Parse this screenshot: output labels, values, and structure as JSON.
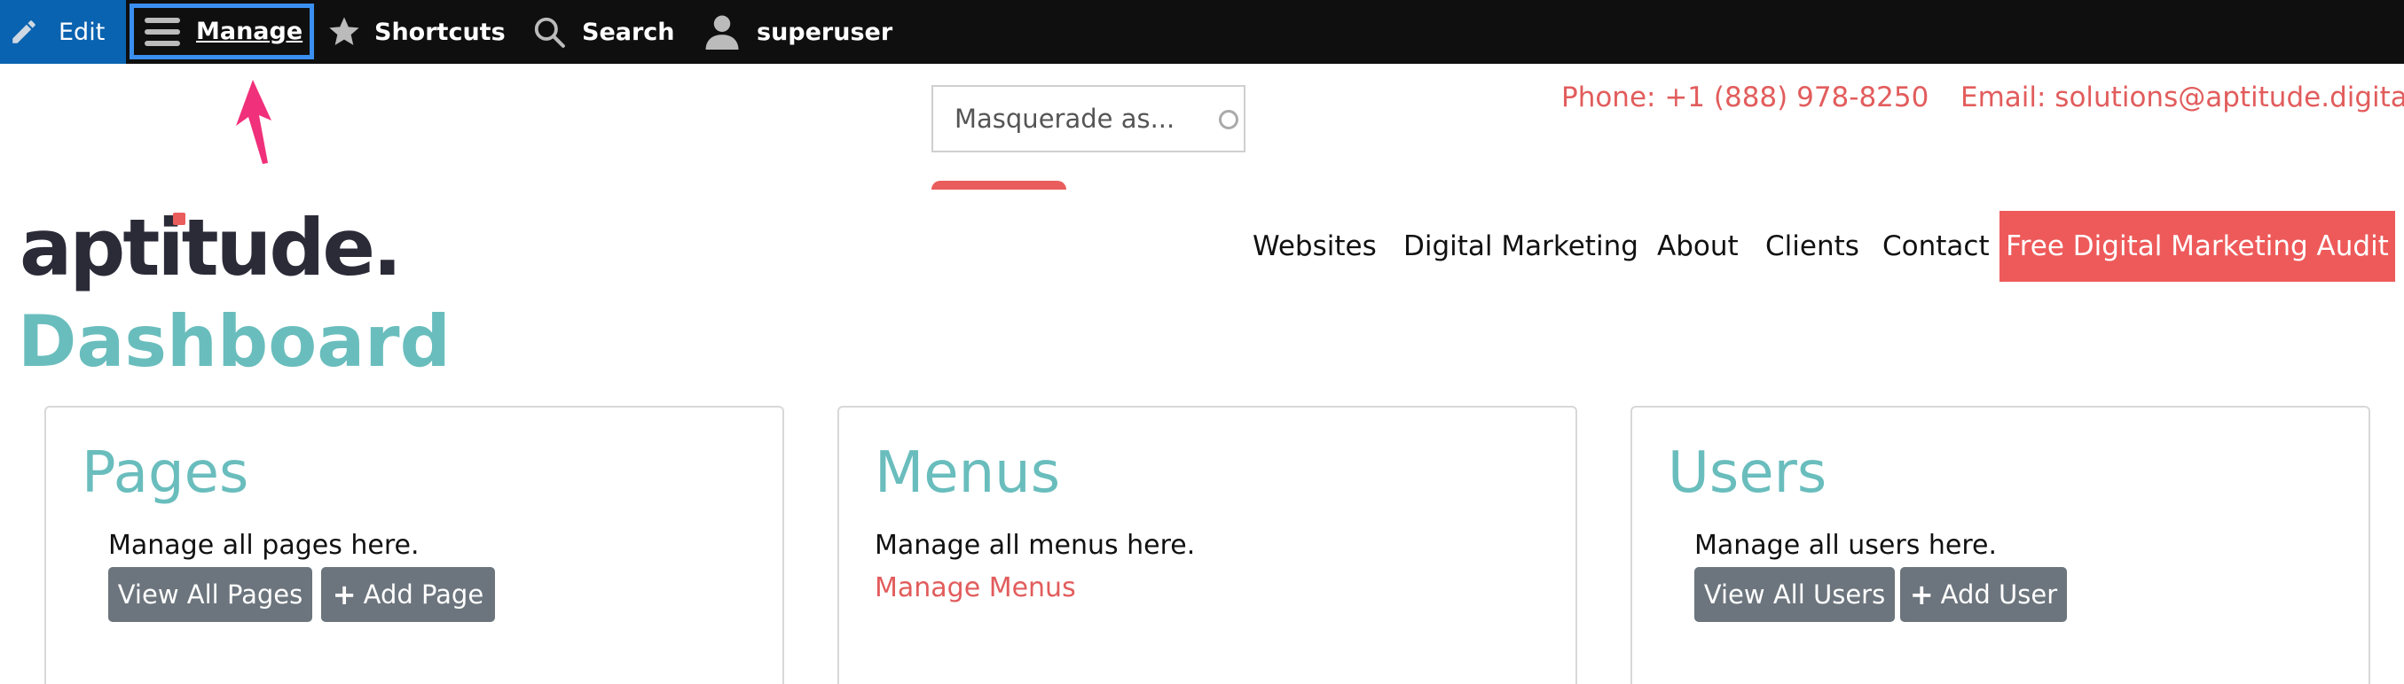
{
  "toolbar": {
    "edit_label": "Edit",
    "manage_label": "Manage",
    "shortcuts_label": "Shortcuts",
    "search_label": "Search",
    "user_label": "superuser"
  },
  "header": {
    "masquerade_placeholder": "Masquerade as...",
    "phone": "Phone: +1 (888) 978-8250",
    "email": "Email: solutions@aptitude.digital",
    "logo_text": "aptitude."
  },
  "nav": {
    "items": [
      "Websites",
      "Digital Marketing",
      "About",
      "Clients",
      "Contact"
    ],
    "cta": "Free Digital Marketing Audit"
  },
  "page": {
    "title": "Dashboard"
  },
  "cards": [
    {
      "title": "Pages",
      "desc": "Manage all pages here.",
      "btn1": "View All Pages",
      "btn2": "Add Page"
    },
    {
      "title": "Menus",
      "desc": "Manage all menus here.",
      "link": "Manage Menus"
    },
    {
      "title": "Users",
      "desc": "Manage all users here.",
      "btn1": "View All Users",
      "btn2": "Add User"
    }
  ],
  "colors": {
    "accent": "#ee5a5a",
    "teal": "#6abdbd",
    "toolbar": "#0f0f0f",
    "edit_blue": "#0a63b0"
  }
}
